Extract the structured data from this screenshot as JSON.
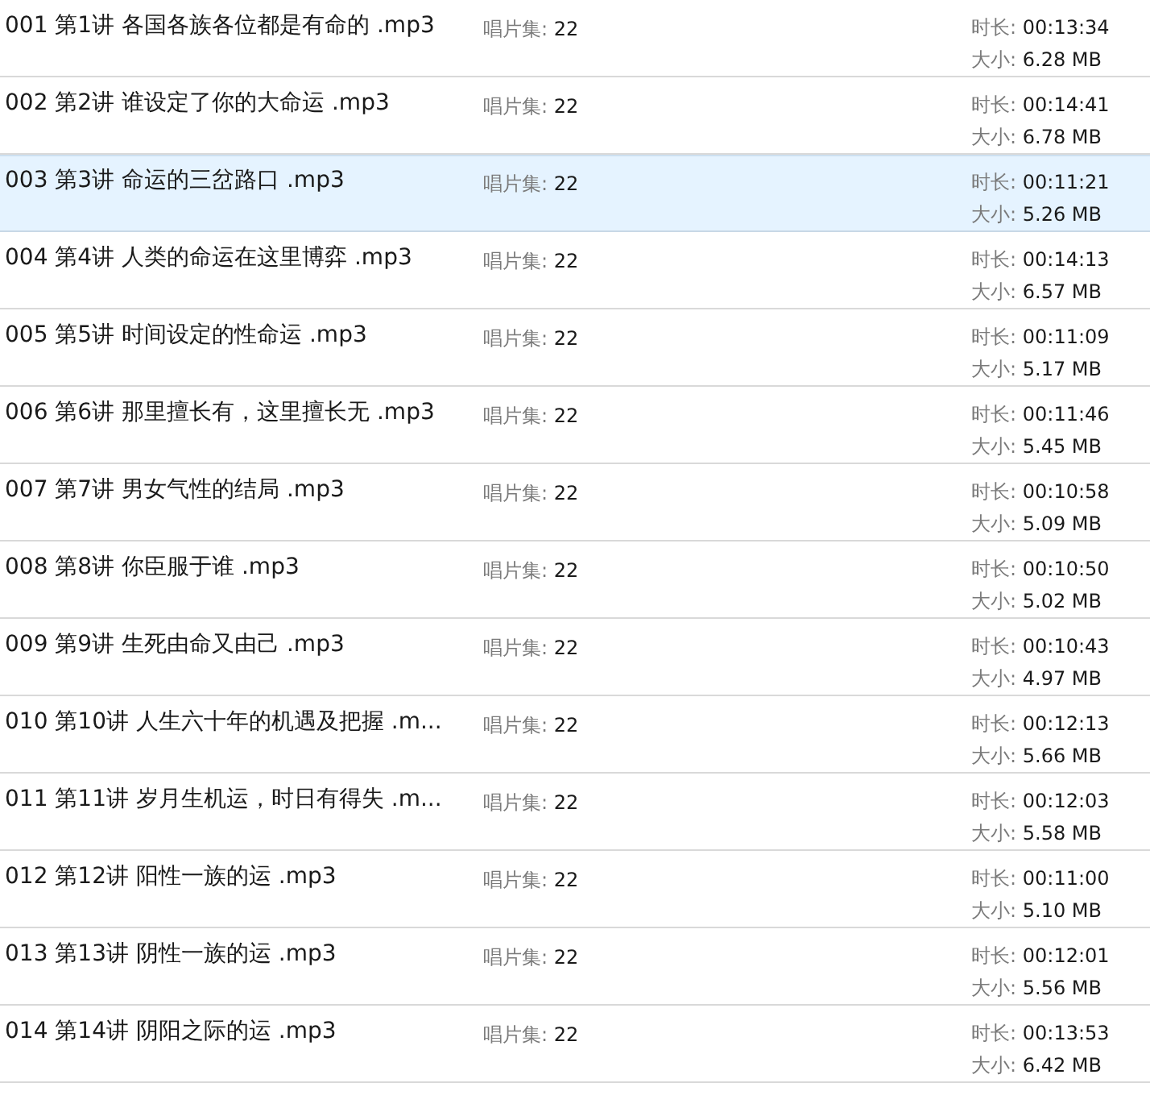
{
  "files": [
    {
      "name": "001 第1讲 各国各族各位都是有命的 .mp3",
      "album_label": "唱片集:",
      "album": "22",
      "duration_label": "时长:",
      "duration": "00:13:34",
      "size_label": "大小:",
      "size": "6.28 MB",
      "selected": false
    },
    {
      "name": "002 第2讲 谁设定了你的大命运 .mp3",
      "album_label": "唱片集:",
      "album": "22",
      "duration_label": "时长:",
      "duration": "00:14:41",
      "size_label": "大小:",
      "size": "6.78 MB",
      "selected": false
    },
    {
      "name": "003 第3讲 命运的三岔路口 .mp3",
      "album_label": "唱片集:",
      "album": "22",
      "duration_label": "时长:",
      "duration": "00:11:21",
      "size_label": "大小:",
      "size": "5.26 MB",
      "selected": true
    },
    {
      "name": "004 第4讲 人类的命运在这里博弈 .mp3",
      "album_label": "唱片集:",
      "album": "22",
      "duration_label": "时长:",
      "duration": "00:14:13",
      "size_label": "大小:",
      "size": "6.57 MB",
      "selected": false
    },
    {
      "name": "005 第5讲 时间设定的性命运 .mp3",
      "album_label": "唱片集:",
      "album": "22",
      "duration_label": "时长:",
      "duration": "00:11:09",
      "size_label": "大小:",
      "size": "5.17 MB",
      "selected": false
    },
    {
      "name": "006 第6讲 那里擅长有，这里擅长无 .mp3",
      "album_label": "唱片集:",
      "album": "22",
      "duration_label": "时长:",
      "duration": "00:11:46",
      "size_label": "大小:",
      "size": "5.45 MB",
      "selected": false
    },
    {
      "name": "007 第7讲 男女气性的结局 .mp3",
      "album_label": "唱片集:",
      "album": "22",
      "duration_label": "时长:",
      "duration": "00:10:58",
      "size_label": "大小:",
      "size": "5.09 MB",
      "selected": false
    },
    {
      "name": "008 第8讲 你臣服于谁 .mp3",
      "album_label": "唱片集:",
      "album": "22",
      "duration_label": "时长:",
      "duration": "00:10:50",
      "size_label": "大小:",
      "size": "5.02 MB",
      "selected": false
    },
    {
      "name": "009 第9讲 生死由命又由己 .mp3",
      "album_label": "唱片集:",
      "album": "22",
      "duration_label": "时长:",
      "duration": "00:10:43",
      "size_label": "大小:",
      "size": "4.97 MB",
      "selected": false
    },
    {
      "name": "010 第10讲 人生六十年的机遇及把握 .m...",
      "album_label": "唱片集:",
      "album": "22",
      "duration_label": "时长:",
      "duration": "00:12:13",
      "size_label": "大小:",
      "size": "5.66 MB",
      "selected": false
    },
    {
      "name": "011 第11讲 岁月生机运，时日有得失 .m...",
      "album_label": "唱片集:",
      "album": "22",
      "duration_label": "时长:",
      "duration": "00:12:03",
      "size_label": "大小:",
      "size": "5.58 MB",
      "selected": false
    },
    {
      "name": "012 第12讲 阳性一族的运 .mp3",
      "album_label": "唱片集:",
      "album": "22",
      "duration_label": "时长:",
      "duration": "00:11:00",
      "size_label": "大小:",
      "size": "5.10 MB",
      "selected": false
    },
    {
      "name": "013 第13讲 阴性一族的运 .mp3",
      "album_label": "唱片集:",
      "album": "22",
      "duration_label": "时长:",
      "duration": "00:12:01",
      "size_label": "大小:",
      "size": "5.56 MB",
      "selected": false
    },
    {
      "name": "014 第14讲 阴阳之际的运 .mp3",
      "album_label": "唱片集:",
      "album": "22",
      "duration_label": "时长:",
      "duration": "00:13:53",
      "size_label": "大小:",
      "size": "6.42 MB",
      "selected": false
    }
  ]
}
